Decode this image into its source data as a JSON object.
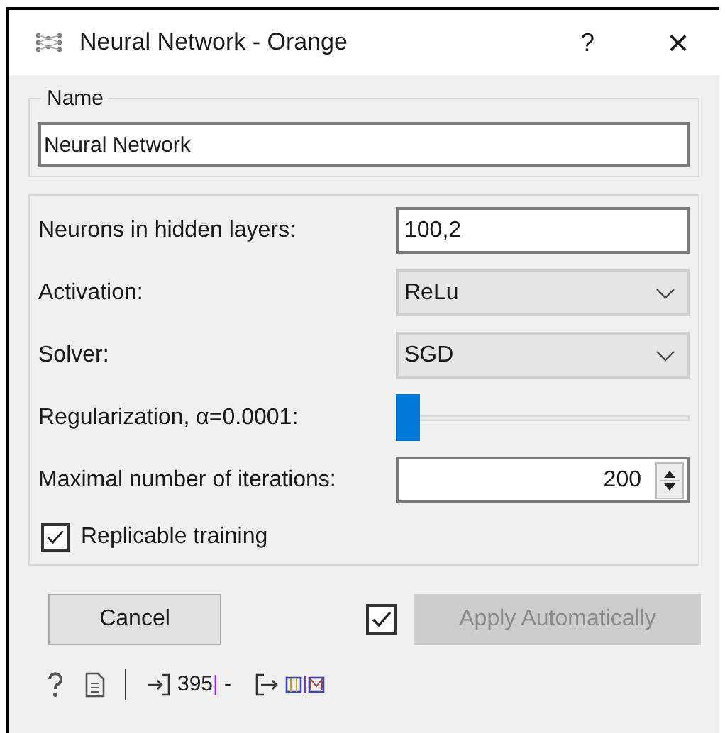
{
  "window": {
    "title": "Neural Network - Orange",
    "help": "?",
    "close": "×"
  },
  "name_group": {
    "label": "Name",
    "value": "Neural Network"
  },
  "parameters": [
    {
      "kind": "text",
      "label": "Neurons in hidden layers:",
      "value": "100,2"
    },
    {
      "kind": "dropdown",
      "label": "Activation:",
      "value": "ReLu"
    },
    {
      "kind": "dropdown",
      "label": "Solver:",
      "value": "SGD"
    },
    {
      "kind": "slider",
      "label": "Regularization, α=0.0001:",
      "level": 0
    },
    {
      "kind": "spin",
      "label": "Maximal number of iterations:",
      "value": "200"
    },
    {
      "kind": "checkbox",
      "label": "Replicable training",
      "checked": true
    }
  ],
  "cancel_button": "Cancel",
  "auto_apply": {
    "checked": true,
    "label": "Apply Automatically",
    "disabled": true
  },
  "status_bar": {
    "input_count": "395",
    "separator": "|",
    "output": "-"
  }
}
